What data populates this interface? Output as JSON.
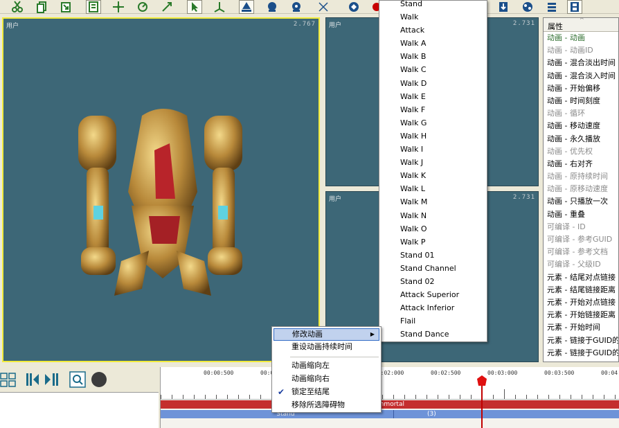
{
  "toolbar": {
    "icons": [
      "cut-icon",
      "copy-icon",
      "paste-icon",
      "frame-icon",
      "move-icon",
      "rotate-icon",
      "scale-icon",
      "select-arrow-icon",
      "axis-icon",
      "camera-a-icon",
      "camera-b-icon",
      "camera-c-icon",
      "bone-icon",
      "fx-icon",
      "record-icon",
      "download-icon",
      "effects-icon",
      "list-icon",
      "film-icon"
    ]
  },
  "viewports": {
    "main": {
      "label": "用户",
      "zoom": "2.767"
    },
    "top_right": {
      "label": "用户",
      "zoom": "2.731"
    },
    "bottom_right": {
      "label": "用户",
      "zoom": "2.731"
    }
  },
  "properties": {
    "header": "属性",
    "rows": [
      {
        "text": "动画 - 动画",
        "style": "green"
      },
      {
        "text": "动画 - 动画ID",
        "style": "gray"
      },
      {
        "text": "动画 - 混合淡出时间",
        "style": "normal"
      },
      {
        "text": "动画 - 混合淡入时间",
        "style": "normal"
      },
      {
        "text": "动画 - 开始偏移",
        "style": "normal"
      },
      {
        "text": "动画 - 时间刻度",
        "style": "normal"
      },
      {
        "text": "动画 - 循环",
        "style": "gray"
      },
      {
        "text": "动画 - 移动速度",
        "style": "normal"
      },
      {
        "text": "动画 - 永久播放",
        "style": "normal"
      },
      {
        "text": "动画 - 优先权",
        "style": "gray"
      },
      {
        "text": "动画 - 右对齐",
        "style": "normal"
      },
      {
        "text": "动画 - 原持续时间",
        "style": "gray"
      },
      {
        "text": "动画 - 原移动速度",
        "style": "gray"
      },
      {
        "text": "动画 - 只播放一次",
        "style": "normal"
      },
      {
        "text": "动画 - 重叠",
        "style": "normal"
      },
      {
        "text": "可编译 - ID",
        "style": "gray"
      },
      {
        "text": "可编译 - 参考GUID",
        "style": "gray"
      },
      {
        "text": "可编译 - 参考文档",
        "style": "gray"
      },
      {
        "text": "可编译 - 父级ID",
        "style": "gray"
      },
      {
        "text": "元素 - 结尾对点链接",
        "style": "normal"
      },
      {
        "text": "元素 - 结尾链接距离",
        "style": "normal"
      },
      {
        "text": "元素 - 开始对点链接",
        "style": "normal"
      },
      {
        "text": "元素 - 开始链接距离",
        "style": "normal"
      },
      {
        "text": "元素 - 开始时间",
        "style": "normal"
      },
      {
        "text": "元素 - 链接于GUID的",
        "style": "normal"
      },
      {
        "text": "元素 - 链接于GUID的",
        "style": "normal"
      }
    ]
  },
  "anim_menu": {
    "items": [
      "Stand",
      "Walk",
      "Attack",
      "Walk A",
      "Walk B",
      "Walk C",
      "Walk D",
      "Walk E",
      "Walk F",
      "Walk G",
      "Walk H",
      "Walk I",
      "Walk J",
      "Walk K",
      "Walk L",
      "Walk M",
      "Walk N",
      "Walk O",
      "Walk P",
      "Stand 01",
      "Stand Channel",
      "Stand 02",
      "Attack Superior",
      "Attack Inferior",
      "Flail",
      "Stand Dance"
    ]
  },
  "context_menu": {
    "items": [
      {
        "label": "修改动画",
        "submenu": true,
        "highlighted": true
      },
      {
        "label": "重设动画持续时间"
      },
      {
        "label": "动画缩向左"
      },
      {
        "label": "动画缩向右"
      },
      {
        "label": "锁定至结尾",
        "checked": true
      },
      {
        "label": "移除所选障碍物"
      }
    ]
  },
  "timeline": {
    "ticks": [
      "00:00:500",
      "00:01:000",
      "00:01:500",
      "00:02:000",
      "00:02:500",
      "00:03:000",
      "00:03:500",
      "00:04:000"
    ],
    "red_track_label": "Immortal",
    "blue_track_label": "Stand",
    "blue_track_count": "(3)"
  },
  "colors": {
    "viewport_bg": "#3d6777",
    "selection_border": "#f2eb3a",
    "red_track": "#c42e2e",
    "blue_track": "#6e93d8",
    "menu_highlight": "#c1d2ee"
  }
}
